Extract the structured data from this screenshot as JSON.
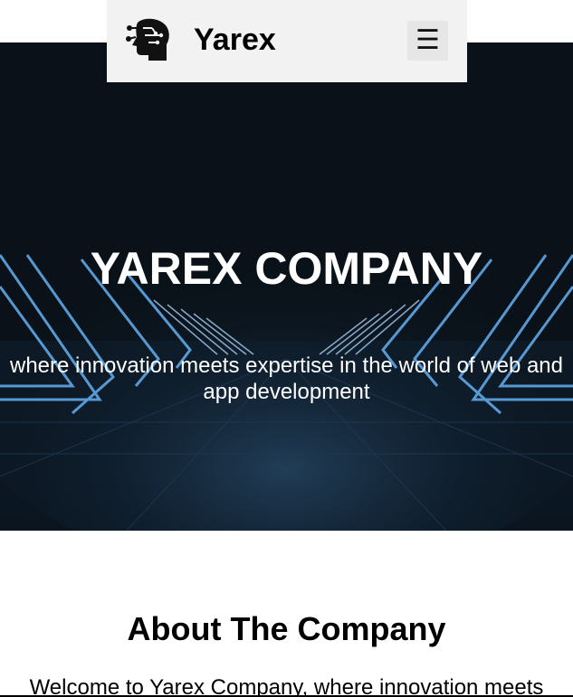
{
  "navbar": {
    "brand": "Yarex",
    "logo_icon": "brain-circuit-head-icon",
    "menu_icon": "hamburger-menu-icon",
    "menu_glyph": "☰"
  },
  "hero": {
    "title": "YAREX COMPANY",
    "subtitle": "where innovation meets expertise in the world of web and app development",
    "background_color": "#0a1118",
    "accent_color": "#4f9fe0"
  },
  "about": {
    "title": "About The Company",
    "text": "Welcome to Yarex Company, where innovation meets"
  }
}
